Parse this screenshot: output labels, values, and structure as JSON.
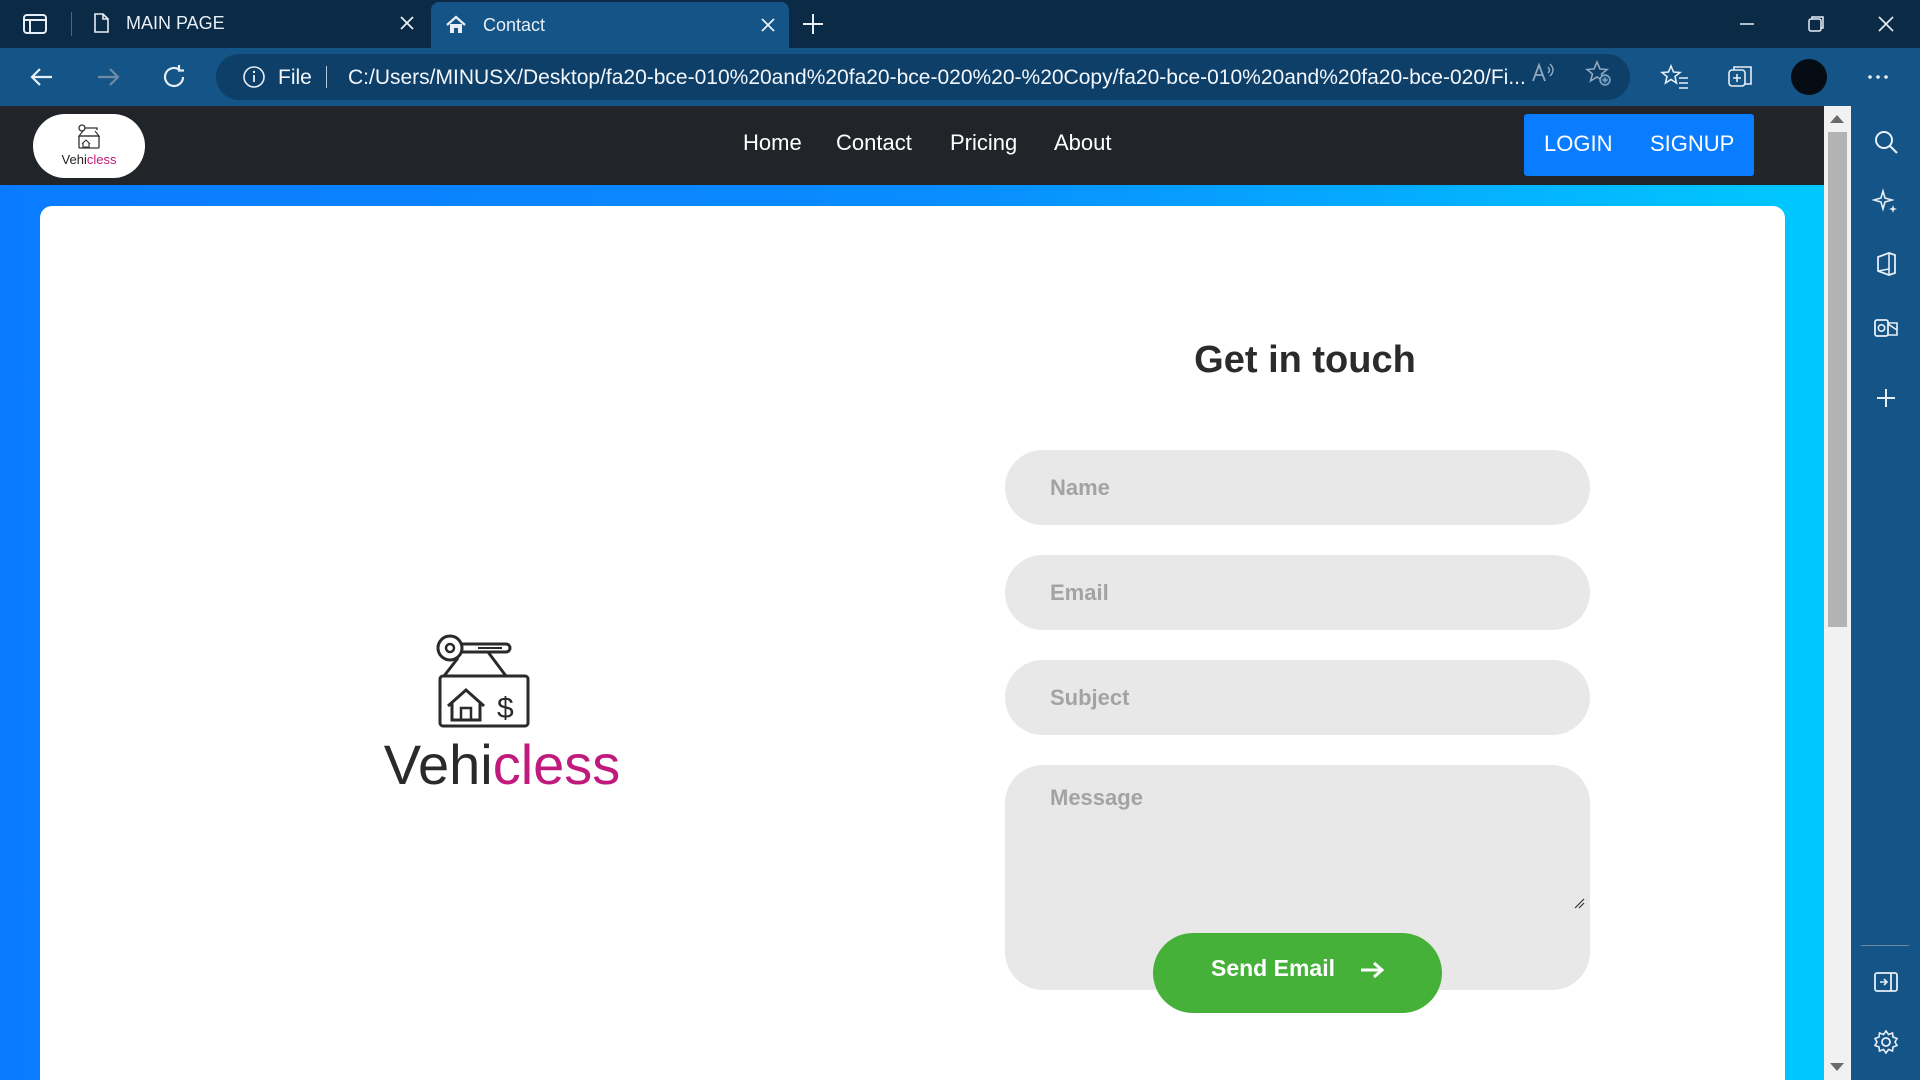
{
  "browser": {
    "tabs": [
      {
        "title": "MAIN PAGE",
        "icon": "page-icon",
        "active": false
      },
      {
        "title": "Contact",
        "icon": "home-icon",
        "active": true
      }
    ],
    "address": {
      "scheme_label": "File",
      "url": "C:/Users/MINUSX/Desktop/fa20-bce-010%20and%20fa20-bce-020%20-%20Copy/fa20-bce-010%20and%20fa20-bce-020/Fi..."
    },
    "colors": {
      "frame": "#0b2a45",
      "toolbar": "#145487"
    }
  },
  "site": {
    "logo_text_dark": "Vehi",
    "logo_text_pink": "cless",
    "nav": [
      "Home",
      "Contact",
      "Pricing",
      "About"
    ],
    "auth": {
      "login": "LOGIN",
      "signup": "SIGNUP"
    },
    "colors": {
      "nav_bg": "#212529",
      "auth_bg": "#0a7cff",
      "gradient_start": "#0a7bff",
      "gradient_end": "#00c8ff",
      "send_button": "#46b139",
      "logo_pink": "#c01a7d"
    }
  },
  "contact": {
    "title": "Get in touch",
    "placeholders": {
      "name": "Name",
      "email": "Email",
      "subject": "Subject",
      "message": "Message"
    },
    "values": {
      "name": "",
      "email": "",
      "subject": "",
      "message": ""
    },
    "send_label": "Send Email"
  }
}
